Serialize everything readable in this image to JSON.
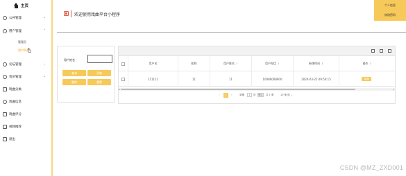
{
  "sidebar": {
    "home_label": "主页",
    "items": [
      {
        "label": "公共管理",
        "icon": "circle-icon",
        "expanded": false
      },
      {
        "label": "用户管理",
        "icon": "user-icon",
        "expanded": true
      },
      {
        "label": "论坛管理",
        "icon": "forum-icon",
        "expanded": false
      },
      {
        "label": "资讯管理",
        "icon": "news-icon",
        "expanded": false
      },
      {
        "label": "戏曲分类",
        "icon": "category-icon",
        "expanded": false
      },
      {
        "label": "戏曲信息",
        "icon": "info-icon",
        "expanded": false
      },
      {
        "label": "戏曲评分",
        "icon": "rating-icon",
        "expanded": false
      },
      {
        "label": "视频推荐",
        "icon": "video-icon",
        "expanded": false
      },
      {
        "label": "退出",
        "icon": "logout-icon",
        "expanded": false
      }
    ],
    "sub_items": [
      {
        "label": "管理员",
        "active": false
      },
      {
        "label": "用户列表",
        "active": true
      }
    ]
  },
  "header": {
    "title": "欢迎使用戏曲平台小程序",
    "user_center": "个人信息",
    "change_password": "修改密码"
  },
  "search": {
    "label": "用户姓名",
    "value": "",
    "buttons": {
      "search": "查询",
      "add": "添加",
      "delete": "删除",
      "reset": "重置"
    }
  },
  "table": {
    "columns": [
      "用户名",
      "昵称",
      "用户姓名",
      "用户电话",
      "新增时间",
      "操作"
    ],
    "rows": [
      {
        "username": "111111",
        "nickname": "11",
        "realname": "11",
        "phone": "10086008900",
        "created": "2024-03-22 09:50:15",
        "action": "详情"
      }
    ]
  },
  "pager": {
    "prev": "‹",
    "current": "1",
    "next": "›",
    "goto_label": "到第",
    "goto_value": "1",
    "page_label": "页",
    "confirm": "确定",
    "total": "共 1 条",
    "page_size": "10 条/页"
  },
  "colors": {
    "accent": "#f7c95a",
    "title_icon": "#e05a47"
  },
  "watermark": "CSDN @MZ_ZXD001"
}
